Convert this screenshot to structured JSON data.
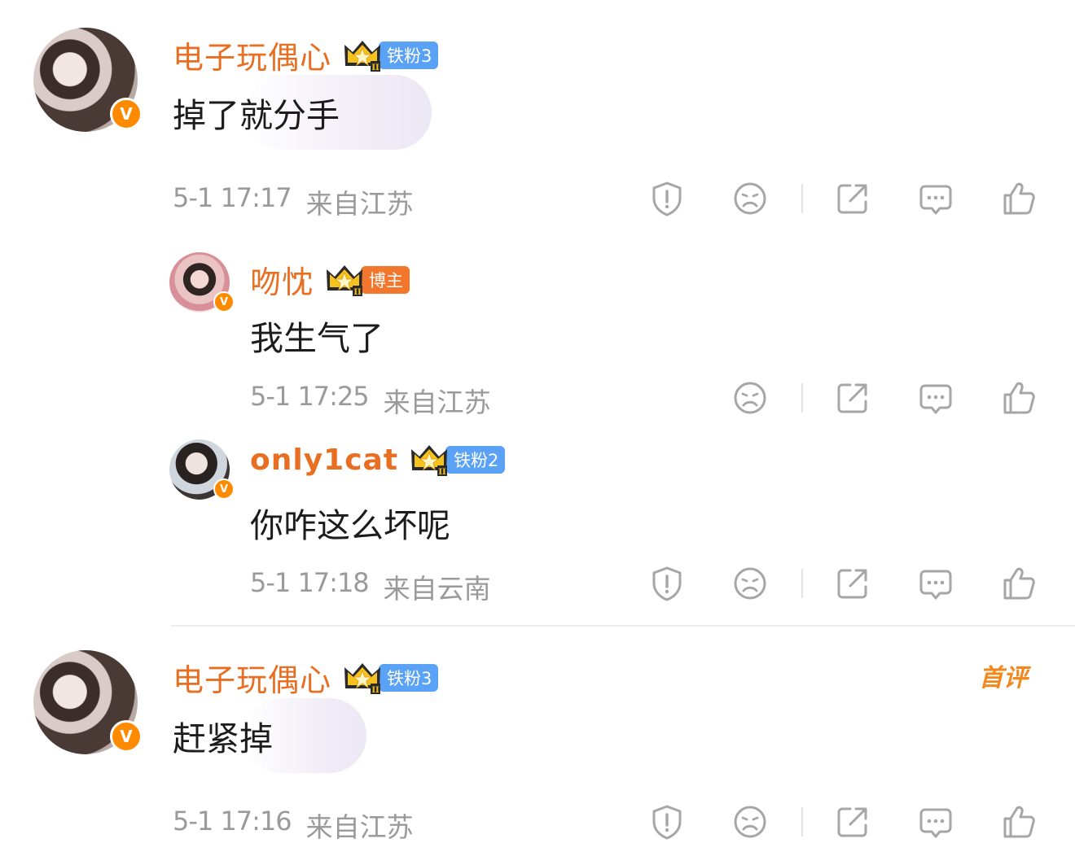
{
  "comments": [
    {
      "username": "电子玩偶心",
      "fan_badge": "铁粉3",
      "text": "掉了就分手",
      "time": "5-1 17:17",
      "location": "来自江苏"
    },
    {
      "username": "吻忱",
      "fan_badge": "博主",
      "text": "我生气了",
      "time": "5-1 17:25",
      "location": "来自江苏"
    },
    {
      "username": "only1cat",
      "fan_badge": "铁粉2",
      "text": "你咋这么坏呢",
      "time": "5-1 17:18",
      "location": "来自云南"
    },
    {
      "username": "电子玩偶心",
      "fan_badge": "铁粉3",
      "text": "赶紧掉",
      "time": "5-1 17:16",
      "location": "来自江苏",
      "top_badge": "首评"
    }
  ],
  "verified_mark": "V",
  "colors": {
    "username": "#e86f22",
    "fan_badge_blue": "#5aa2f6",
    "blogger_badge_orange": "#f2762c",
    "meta_gray": "#9a9a9a",
    "icon_gray": "#a6a6a6"
  },
  "icons": [
    "report-icon",
    "dislike-face-icon",
    "share-icon",
    "comment-icon",
    "like-icon",
    "crown-icon"
  ]
}
